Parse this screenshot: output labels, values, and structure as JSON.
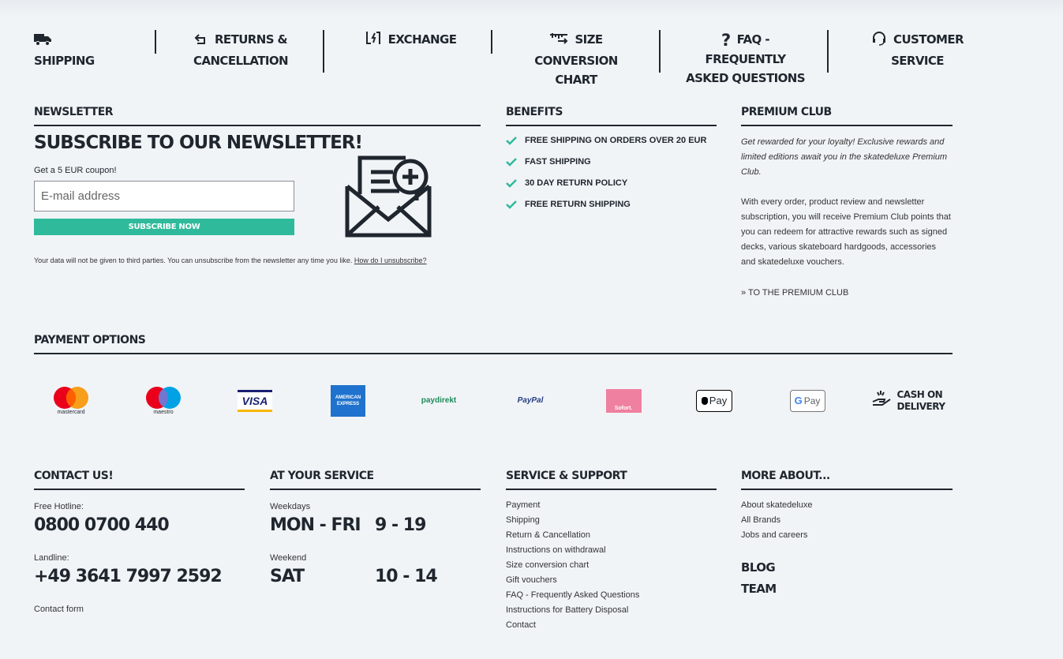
{
  "service_bar": [
    {
      "icon": "truck-icon",
      "line1": "Shipping",
      "line2": ""
    },
    {
      "icon": "return-arrow-icon",
      "line1": "Returns &",
      "line2": "Cancellation"
    },
    {
      "icon": "exchange-icon",
      "line1": "Exchange",
      "line2": ""
    },
    {
      "icon": "size-ruler-icon",
      "line1": "Size Conversion",
      "line2": "Chart"
    },
    {
      "icon": "question-icon",
      "line1": "FAQ - Frequently",
      "line2": "Asked Questions"
    },
    {
      "icon": "headset-icon",
      "line1": "Customer Service",
      "line2": ""
    }
  ],
  "newsletter": {
    "section_title": "Newsletter",
    "headline": "Subscribe to our newsletter!",
    "coupon_text": "Get a 5 EUR coupon!",
    "email_placeholder": "E-mail address",
    "email_value": "",
    "button_label": "Subscribe now",
    "disclaimer": "Your data will not be given to third parties. You can unsubscribe from the newsletter any time you like.",
    "unsubscribe_link": "How do I unsubscribe?"
  },
  "benefits": {
    "title": "Benefits",
    "items": [
      "FREE SHIPPING ON ORDERS OVER 20 EUR",
      "FAST SHIPPING",
      "30 DAY RETURN POLICY",
      "FREE RETURN SHIPPING"
    ],
    "check_color": "#2fba9b"
  },
  "premium": {
    "title": "Premium Club",
    "intro": "Get rewarded for your loyalty! Exclusive rewards and limited editions await you in the skatedeluxe Premium Club.",
    "body": "With every order, product review and newsletter subscription, you will receive Premium Club points that you can redeem for attractive rewards such as signed decks, various skateboard hardgoods, accessories and skatedeluxe vouchers.",
    "link": "» TO THE PREMIUM CLUB"
  },
  "payment": {
    "title": "Payment Options",
    "methods": [
      {
        "name": "mastercard",
        "label": "mastercard"
      },
      {
        "name": "maestro",
        "label": "maestro"
      },
      {
        "name": "visa",
        "label": "VISA"
      },
      {
        "name": "american-express",
        "label": "AMERICAN EXPRESS"
      },
      {
        "name": "paydirekt",
        "label": "paydirekt"
      },
      {
        "name": "paypal",
        "label": "PayPal"
      },
      {
        "name": "sofort",
        "label": "Sofort."
      },
      {
        "name": "apple-pay",
        "label": "Pay"
      },
      {
        "name": "google-pay",
        "label": "Pay"
      },
      {
        "name": "cash-on-delivery",
        "label1": "Cash on",
        "label2": "Delivery"
      }
    ]
  },
  "contact": {
    "title": "Contact us!",
    "hotline_label": "Free Hotline:",
    "hotline": "0800 0700 440",
    "landline_label": "Landline:",
    "landline": "+49 3641 7997 2592",
    "form_link": "Contact form"
  },
  "service_hours": {
    "title": "At your service",
    "weekdays_label": "Weekdays",
    "weekdays_days": "Mon - Fri",
    "weekdays_hours": "9 - 19",
    "weekend_label": "Weekend",
    "weekend_days": "Sat",
    "weekend_hours": "10 - 14"
  },
  "support": {
    "title": "Service & Support",
    "links": [
      "Payment",
      "Shipping",
      "Return & Cancellation",
      "Instructions on withdrawal",
      "Size conversion chart",
      "Gift vouchers",
      "FAQ - Frequently Asked Questions",
      "Instructions for Battery Disposal",
      "Contact"
    ]
  },
  "more": {
    "title": "More about...",
    "links": [
      "About skatedeluxe",
      "All Brands",
      "Jobs and careers"
    ],
    "blog": "Blog",
    "team": "Team"
  },
  "colors": {
    "accent": "#2fba9b",
    "text": "#1f262e",
    "background": "#f1f4f7"
  }
}
